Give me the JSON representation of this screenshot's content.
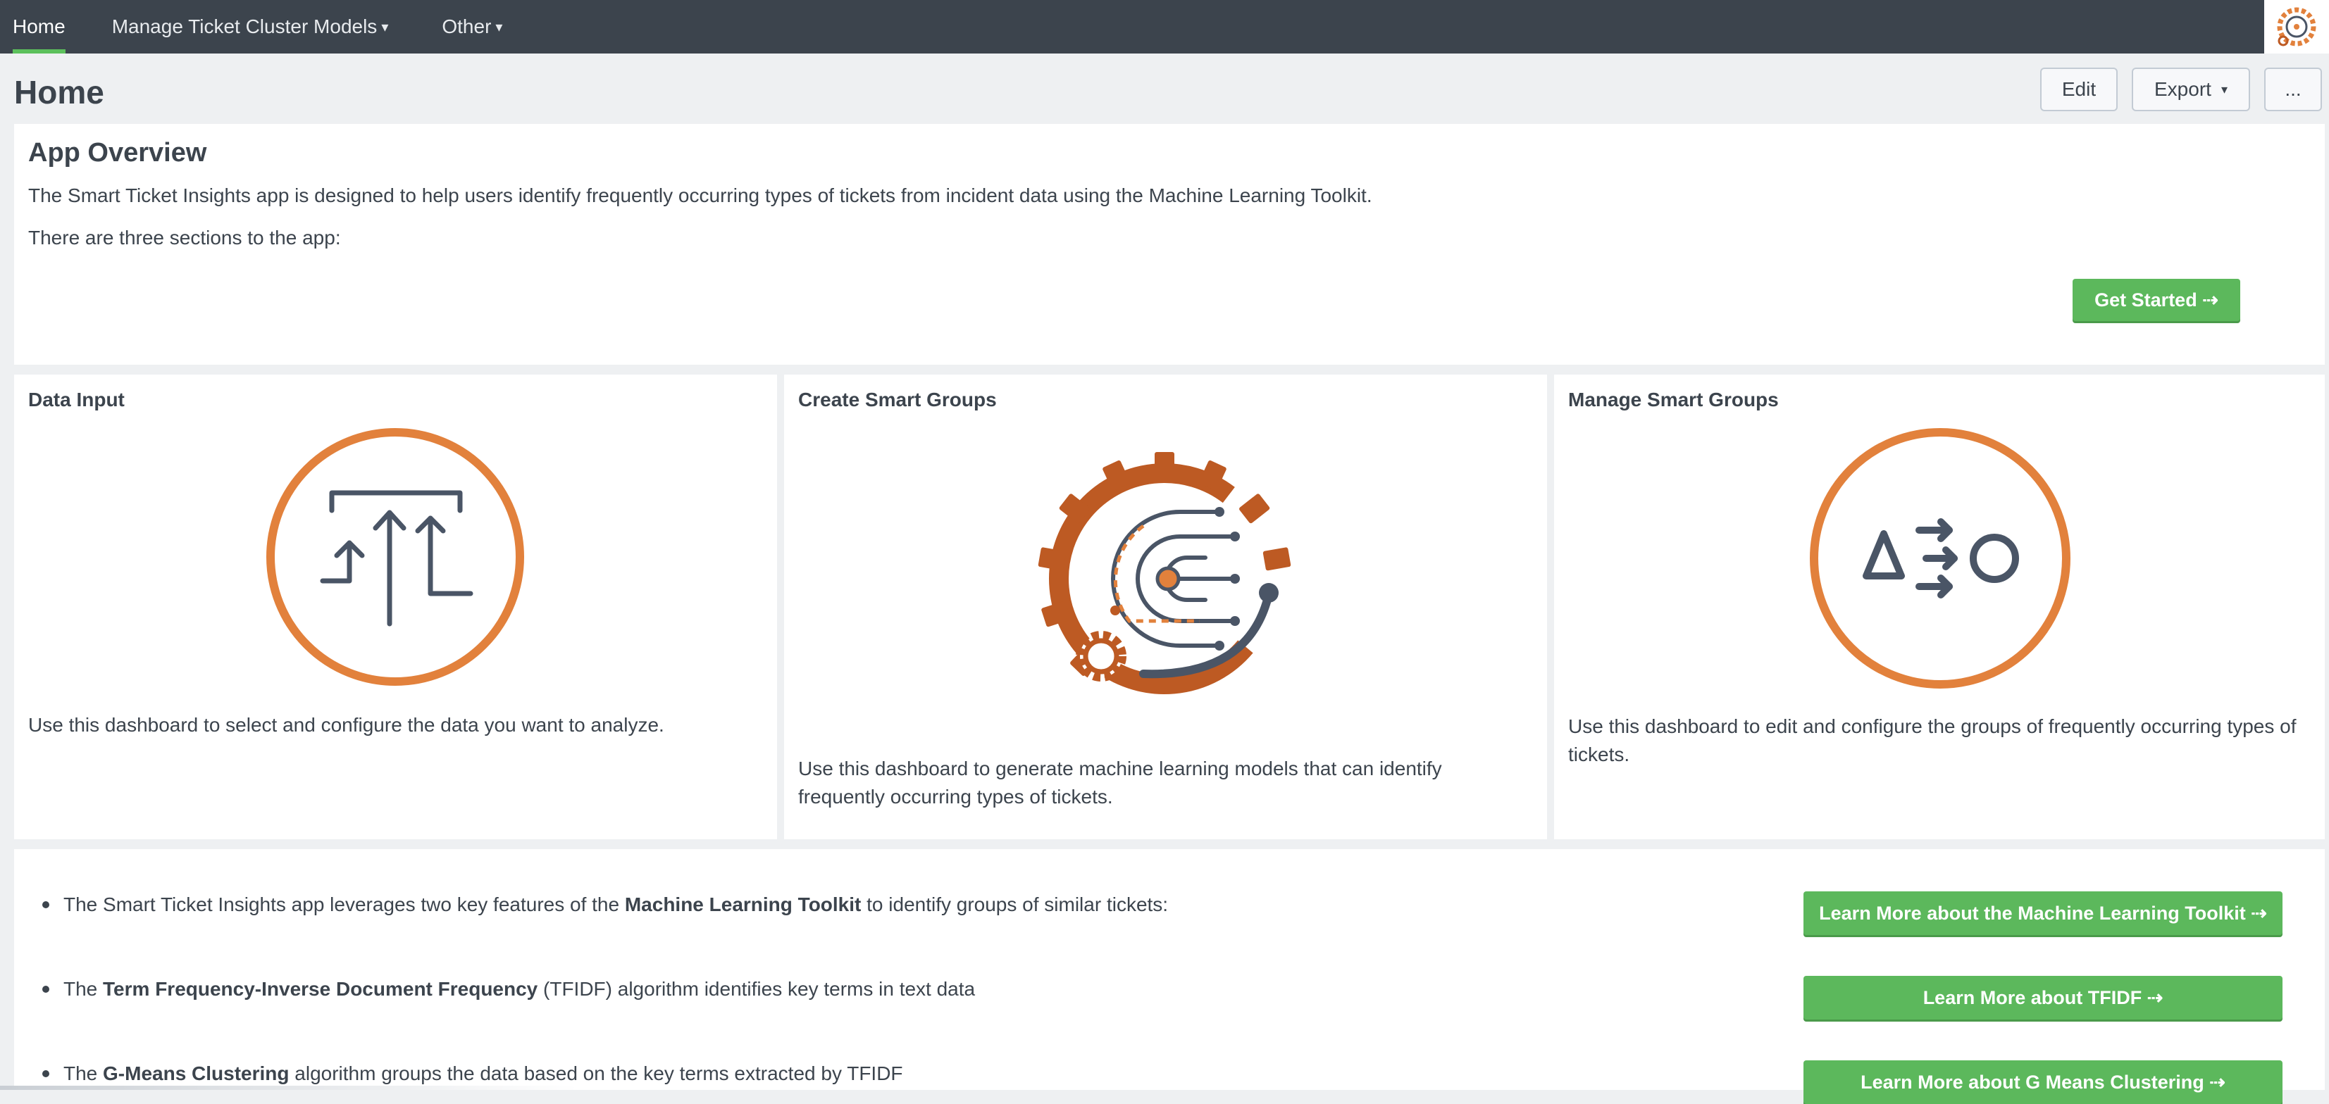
{
  "nav": {
    "items": [
      {
        "label": "Home"
      },
      {
        "label": "Manage Ticket Cluster Models"
      },
      {
        "label": "Other"
      }
    ],
    "caret": "▾"
  },
  "page": {
    "title": "Home",
    "buttons": {
      "edit": "Edit",
      "export": "Export",
      "more": "..."
    }
  },
  "overview": {
    "title": "App Overview",
    "p1": "The Smart Ticket Insights app is designed to help users identify frequently occurring types of tickets from incident data using the Machine Learning Toolkit.",
    "p2": "There are three sections to the app:",
    "get_started": "Get Started ⇢"
  },
  "cards": [
    {
      "title": "Data Input",
      "text": "Use this dashboard to select and configure the data you want to analyze.",
      "icon": "upload-arrows-icon"
    },
    {
      "title": "Create Smart Groups",
      "text": "Use this dashboard to generate machine learning models that can identify frequently occurring types of tickets.",
      "icon": "gear-ml-icon"
    },
    {
      "title": "Manage Smart Groups",
      "text": "Use this dashboard to edit and configure the groups of frequently occurring types of tickets.",
      "icon": "shapes-transform-icon"
    }
  ],
  "features": [
    {
      "pre": "The Smart Ticket Insights app leverages two key features of the ",
      "bold": "Machine Learning Toolkit",
      "post": " to identify groups of similar tickets:",
      "button": "Learn More about the Machine Learning Toolkit ⇢"
    },
    {
      "pre": "The ",
      "bold": "Term Frequency-Inverse Document Frequency",
      "post": " (TFIDF) algorithm identifies key terms in text data",
      "button": "Learn More about TFIDF ⇢"
    },
    {
      "pre": "The ",
      "bold": "G-Means Clustering",
      "post": " algorithm groups the data based on the key terms extracted by TFIDF",
      "button": "Learn More about G Means Clustering ⇢"
    }
  ],
  "colors": {
    "accent_green": "#5cb85c",
    "nav_bg": "#3c444d",
    "icon_orange": "#e2813c",
    "icon_dark_orange": "#bd5a23",
    "icon_slate": "#4a5566"
  }
}
